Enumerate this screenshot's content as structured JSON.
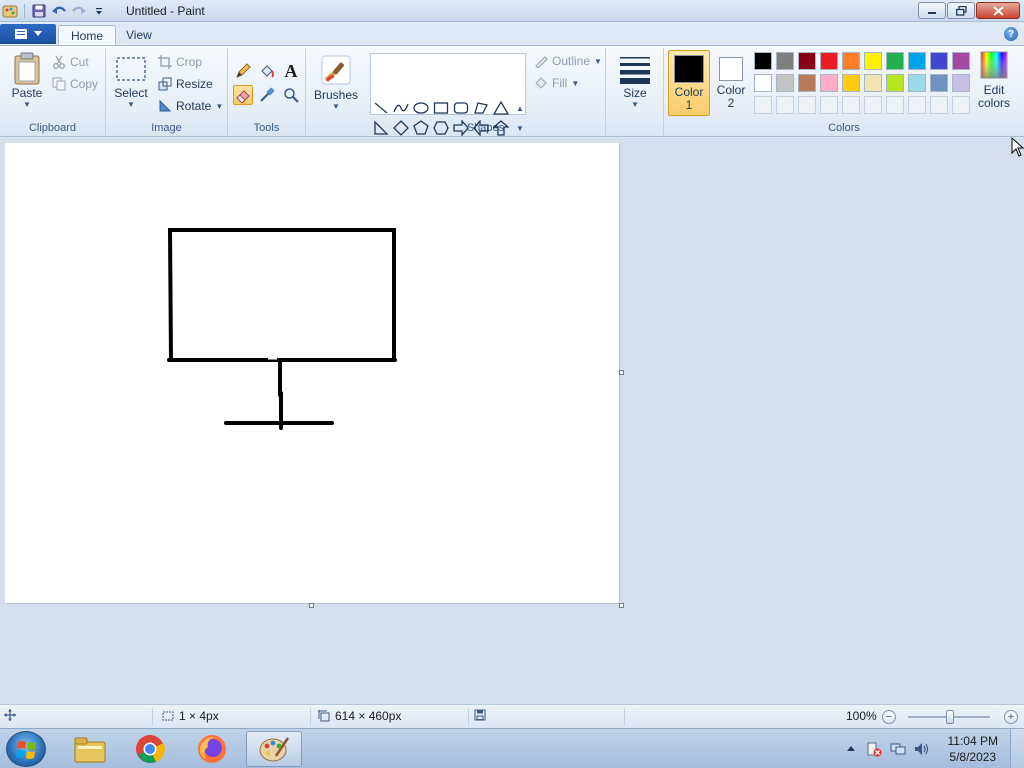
{
  "window": {
    "title": "Untitled - Paint"
  },
  "tabs": {
    "home": "Home",
    "view": "View",
    "help": "?"
  },
  "clipboard": {
    "paste": "Paste",
    "cut": "Cut",
    "copy": "Copy",
    "label": "Clipboard"
  },
  "image": {
    "select": "Select",
    "crop": "Crop",
    "resize": "Resize",
    "rotate": "Rotate",
    "label": "Image"
  },
  "tools": {
    "label": "Tools",
    "text_tool": "A"
  },
  "brushes": {
    "label": "Brushes"
  },
  "shapes": {
    "outline": "Outline",
    "fill": "Fill",
    "label": "Shapes"
  },
  "size": {
    "label": "Size"
  },
  "colors": {
    "color1_line1": "Color",
    "color1_line2": "1",
    "color2_line1": "Color",
    "color2_line2": "2",
    "color1_value": "#000000",
    "color2_value": "#ffffff",
    "edit_line1": "Edit",
    "edit_line2": "colors",
    "label": "Colors",
    "palette_row1": [
      "#000000",
      "#7f7f7f",
      "#880015",
      "#ed1c24",
      "#ff7f27",
      "#fff200",
      "#22b14c",
      "#00a2e8",
      "#3f48cc",
      "#a349a4"
    ],
    "palette_row2": [
      "#ffffff",
      "#c3c3c3",
      "#b97a57",
      "#ffaec9",
      "#ffc90e",
      "#efe4b0",
      "#b5e61d",
      "#99d9ea",
      "#7092be",
      "#c8bfe7"
    ]
  },
  "status": {
    "selection_size": "1 × 4px",
    "canvas_size": "614 × 460px",
    "zoom": "100%"
  },
  "taskbar": {
    "time": "11:04 PM",
    "date": "5/8/2023"
  }
}
